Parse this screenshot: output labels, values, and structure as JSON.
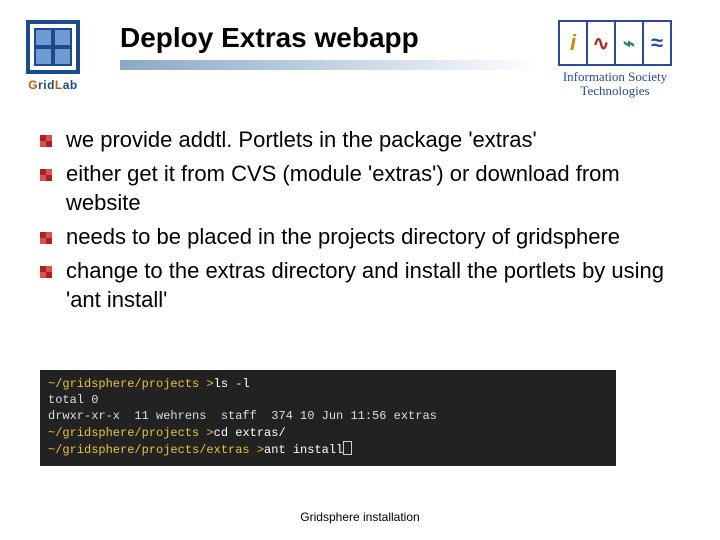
{
  "logo_left": {
    "label_html": "GridLab"
  },
  "logo_right": {
    "line1": "Information Society",
    "line2": "Technologies"
  },
  "title": "Deploy Extras webapp",
  "bullets": [
    "we provide addtl. Portlets in the package 'extras'",
    "either get it from CVS (module 'extras') or download from website",
    "needs to be placed in the projects directory of gridsphere",
    "change to the extras directory and install the portlets by using 'ant install'"
  ],
  "terminal": {
    "lines": [
      {
        "prompt": "~/gridsphere/projects >",
        "cmd": "ls -l"
      },
      {
        "out": "total 0"
      },
      {
        "out": "drwxr-xr-x  11 wehrens  staff  374 10 Jun 11:56 extras"
      },
      {
        "prompt": "~/gridsphere/projects >",
        "cmd": "cd extras/"
      },
      {
        "prompt": "~/gridsphere/projects/extras >",
        "cmd": "ant install",
        "cursor": true
      }
    ]
  },
  "footer": "Gridsphere installation"
}
